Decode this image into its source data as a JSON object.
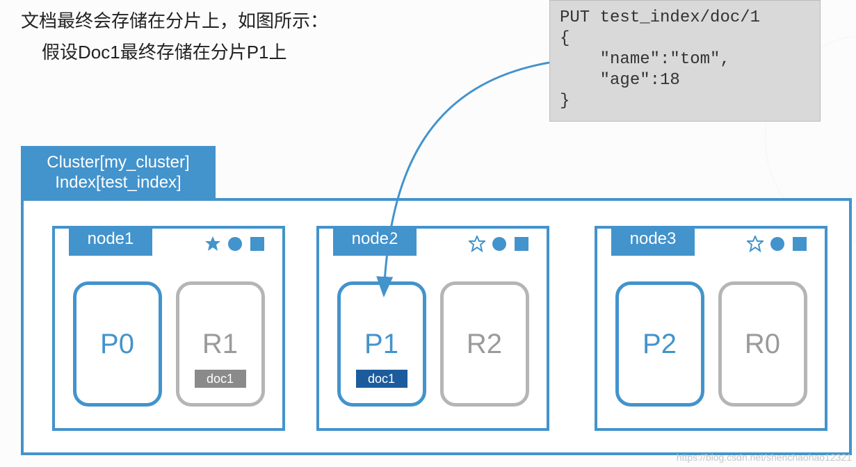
{
  "intro": {
    "line1": "文档最终会存储在分片上，如图所示：",
    "line2": "假设Doc1最终存储在分片P1上"
  },
  "request": {
    "code": "PUT test_index/doc/1\n{\n    \"name\":\"tom\",\n    \"age\":18\n}"
  },
  "cluster": {
    "name_label": "Cluster[my_cluster]",
    "index_label": "Index[test_index]"
  },
  "nodes": [
    {
      "name": "node1",
      "master": true,
      "shards": [
        {
          "id": "P0",
          "type": "primary",
          "doc": null
        },
        {
          "id": "R1",
          "type": "replica",
          "doc": "doc1"
        }
      ]
    },
    {
      "name": "node2",
      "master": false,
      "shards": [
        {
          "id": "P1",
          "type": "primary",
          "doc": "doc1"
        },
        {
          "id": "R2",
          "type": "replica",
          "doc": null
        }
      ]
    },
    {
      "name": "node3",
      "master": false,
      "shards": [
        {
          "id": "P2",
          "type": "primary",
          "doc": null
        },
        {
          "id": "R0",
          "type": "replica",
          "doc": null
        }
      ]
    }
  ],
  "colors": {
    "accent": "#4393cc",
    "gray": "#8a8a8a",
    "code_bg": "#d9d9d9"
  },
  "watermark": "https://blog.csdn.net/shenchaohao12321"
}
